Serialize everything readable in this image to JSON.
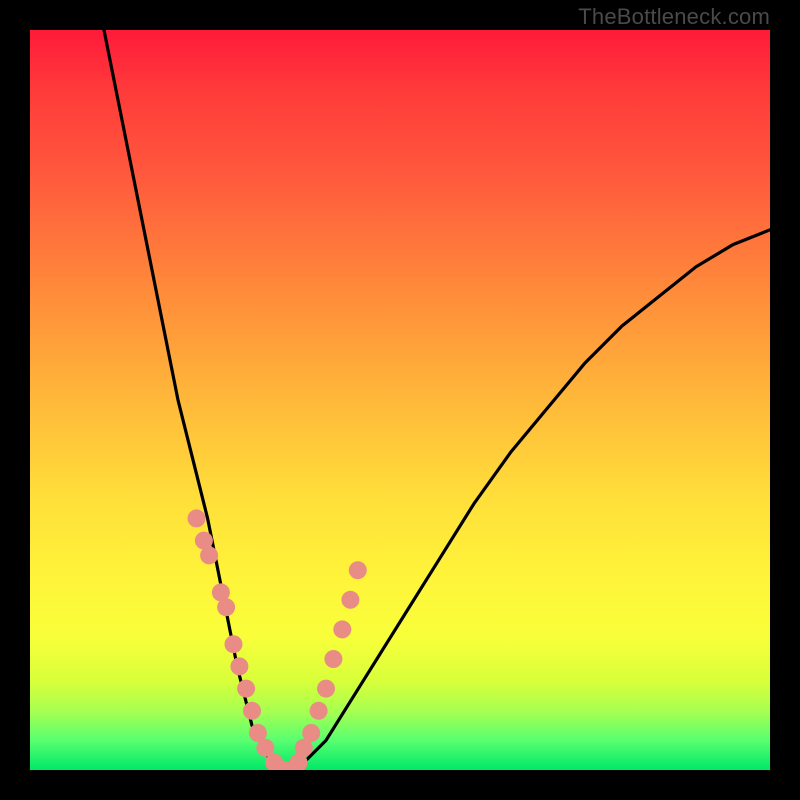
{
  "attribution": "TheBottleneck.com",
  "chart_data": {
    "type": "line",
    "title": "",
    "xlabel": "",
    "ylabel": "",
    "xlim": [
      0,
      100
    ],
    "ylim": [
      0,
      100
    ],
    "grid": false,
    "legend": false,
    "series": [
      {
        "name": "bottleneck-curve",
        "color": "#000000",
        "x": [
          10,
          12,
          14,
          16,
          18,
          20,
          22,
          24,
          26,
          28,
          30,
          32,
          34,
          36,
          40,
          45,
          50,
          55,
          60,
          65,
          70,
          75,
          80,
          85,
          90,
          95,
          100
        ],
        "y": [
          100,
          90,
          80,
          70,
          60,
          50,
          42,
          34,
          24,
          14,
          6,
          2,
          0,
          0,
          4,
          12,
          20,
          28,
          36,
          43,
          49,
          55,
          60,
          64,
          68,
          71,
          73
        ]
      }
    ],
    "markers": {
      "name": "salmon-dots",
      "color": "#e98c86",
      "x": [
        22.5,
        23.5,
        24.2,
        25.8,
        26.5,
        27.5,
        28.3,
        29.2,
        30.0,
        30.8,
        31.8,
        33.0,
        34.5,
        35.5,
        36.3,
        37.0,
        38.0,
        39.0,
        40.0,
        41.0,
        42.2,
        43.3,
        44.3
      ],
      "y": [
        34,
        31,
        29,
        24,
        22,
        17,
        14,
        11,
        8,
        5,
        3,
        1,
        0,
        0,
        1,
        3,
        5,
        8,
        11,
        15,
        19,
        23,
        27
      ]
    },
    "background_gradient": {
      "direction": "top-to-bottom",
      "stops": [
        {
          "pos": 0,
          "color": "#ff1a3a"
        },
        {
          "pos": 50,
          "color": "#ffb83a"
        },
        {
          "pos": 80,
          "color": "#f8ff3a"
        },
        {
          "pos": 100,
          "color": "#00e868"
        }
      ]
    }
  }
}
